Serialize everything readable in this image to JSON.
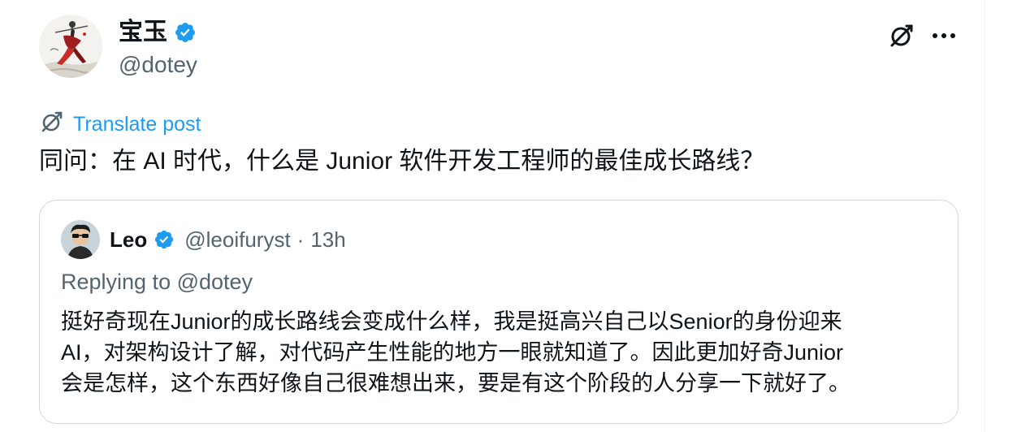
{
  "post": {
    "author": {
      "display_name": "宝玉",
      "handle": "@dotey",
      "verified": true,
      "avatar_icon": "avatar-ink-painting"
    },
    "actions": {
      "grok_icon": "grok-icon",
      "more_icon": "more-icon"
    },
    "translate_label": "Translate post",
    "text": "同问：在 AI 时代，什么是 Junior 软件开发工程师的最佳成长路线？"
  },
  "quote": {
    "author": {
      "display_name": "Leo",
      "handle": "@leoifuryst",
      "separator": "·",
      "time": "13h",
      "verified": true
    },
    "replying_to": "Replying to @dotey",
    "body_lines": [
      "挺好奇现在Junior的成长路线会变成什么样，我是挺高兴自己以Senior的身份迎来",
      "AI，对架构设计了解，对代码产生性能的地方一眼就知道了。因此更加好奇Junior",
      "会是怎样，这个东西好像自己很难想出来，要是有这个阶段的人分享一下就好了。"
    ]
  },
  "colors": {
    "verified": "#1d9bf0",
    "link": "#1d9bf0",
    "secondary_text": "#536471",
    "border": "#cfd9de"
  }
}
